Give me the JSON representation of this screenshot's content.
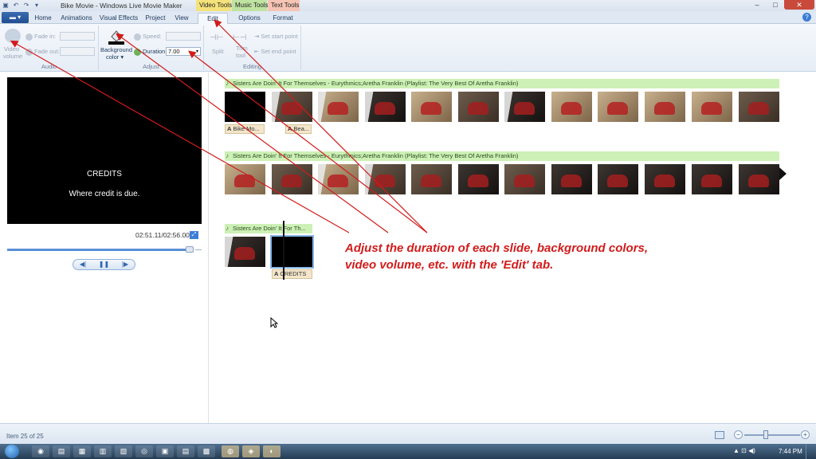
{
  "window": {
    "title": "Bike Movie - Windows Live Movie Maker",
    "contextual_tabs": [
      "Video Tools",
      "Music Tools",
      "Text Tools"
    ],
    "buttons": {
      "minimize": "–",
      "maximize": "□",
      "close": "✕"
    }
  },
  "quick_access": [
    "▣",
    "↶",
    "↷",
    "▾"
  ],
  "tabs": [
    "Home",
    "Animations",
    "Visual Effects",
    "Project",
    "View",
    "Edit",
    "Options",
    "Format"
  ],
  "active_tab": "Edit",
  "app_menu_label": "▬ ▾",
  "ribbon": {
    "audio": {
      "label": "Audio",
      "video_volume_label": "Video",
      "video_volume_label2": "volume",
      "fade_in_label": "Fade in:",
      "fade_out_label": "Fade out:"
    },
    "adjust": {
      "label": "Adjust",
      "background_color_label": "Background",
      "background_color_label2": "color ▾",
      "speed_label": "Speed:",
      "duration_label": "Duration:",
      "duration_value": "7.00"
    },
    "editing": {
      "label": "Editing",
      "split_label": "Split",
      "trim_tool_label": "Trim",
      "trim_tool_label2": "tool",
      "set_start_label": "Set start point",
      "set_end_label": "Set end point"
    }
  },
  "preview": {
    "title": "CREDITS",
    "subtitle": "Where credit is due.",
    "timecode": "02:51.11/02:56.00",
    "seek_fraction": 0.97,
    "controls": {
      "previous": "◀|",
      "pause": "❚❚",
      "next": "|▶"
    }
  },
  "storyboard": {
    "rows": [
      {
        "music": "Sisters Are Doin' It For Themselves - Eurythmics;Aretha Franklin (Playlist: The Very Best Of Aretha Franklin)"
      },
      {
        "music": "Sisters Are Doin' It For Themselves - Eurythmics;Aretha Franklin (Playlist: The Very Best Of Aretha Franklin)"
      },
      {
        "music": "Sisters Are Doin' It For Th..."
      }
    ],
    "captions": [
      {
        "icon": "A",
        "text": "Bike Mo..."
      },
      {
        "icon": "A",
        "text": "Bea..."
      },
      {
        "icon": "A",
        "text": "CREDITS"
      }
    ]
  },
  "annotation": {
    "line1": "Adjust the duration of each slide, background colors,",
    "line2": "video volume, etc. with the 'Edit' tab.",
    "color": "#d21b1b"
  },
  "status": {
    "item_text": "Item 25 of 25",
    "zoom_minus": "−",
    "zoom_plus": "+"
  },
  "taskbar": {
    "apps": [
      "◉",
      "▤",
      "▦",
      "▥",
      "▧",
      "◎",
      "▣",
      "▤",
      "▩",
      "◍"
    ],
    "clock": "7:44 PM",
    "tray": "▲ ⊡ ◀)"
  },
  "colors": {
    "accent": "#3b7dd8",
    "music_bar": "#cdf0b6",
    "video_tools": "#f4e27a",
    "music_tools": "#bfe3a1",
    "text_tools": "#f6c4b4"
  }
}
